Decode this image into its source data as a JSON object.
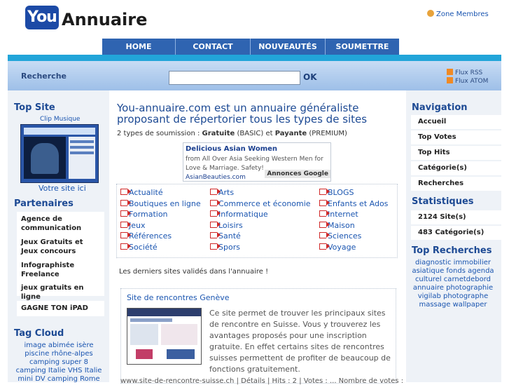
{
  "header": {
    "logo_you": "You",
    "logo_text": "Annuaire",
    "zone_membres": "Zone Membres"
  },
  "nav": [
    "HOME",
    "CONTACT",
    "NOUVEAUTÉS",
    "SOUMETTRE"
  ],
  "search": {
    "label": "Recherche",
    "ok": "OK",
    "feed_rss": "Flux RSS",
    "feed_atom": "Flux ATOM"
  },
  "left": {
    "top_site_title": "Top Site",
    "top_site_caption": "Clip Musique",
    "votre_site": "Votre site ici",
    "partenaires_title": "Partenaires",
    "partenaires": [
      "Agence de communication",
      "Jeux Gratuits et Jeux concours",
      "Infographiste Freelance",
      "jeux gratuits en ligne",
      "GAGNE TON iPAD"
    ],
    "tag_cloud_title": "Tag Cloud",
    "tag_cloud_text": "image abimée isère piscine rhône-alpes camping super 8 camping Italie VHS Italie mini DV camping Rome"
  },
  "main": {
    "title": "You-annuaire.com est un annuaire généraliste proposant de répertorier tous les types de sites",
    "soumission_prefix": "2 types de soumission : ",
    "soumission_gratuite": "Gratuite",
    "soumission_mid": " (BASIC) et ",
    "soumission_payante": "Payante",
    "soumission_suffix": " (PREMIUM)",
    "ad": {
      "title": "Delicious Asian Women",
      "text": "from All Over Asia Seeking Western Men for Love & Marriage. Safety!",
      "url": "AsianBeauties.com",
      "badge": "Annonces Google"
    },
    "categories": [
      [
        "Actualité",
        "Arts",
        "BLOGS"
      ],
      [
        "Boutiques en ligne",
        "Commerce et économie",
        "Enfants et Ados"
      ],
      [
        "Formation",
        "Informatique",
        "Internet"
      ],
      [
        "Jeux",
        "Loisirs",
        "Maison"
      ],
      [
        "Références",
        "Santé",
        "Sciences"
      ],
      [
        "Société",
        "Spors",
        "Voyage"
      ]
    ],
    "derniers": "Les derniers sites validés dans l'annuaire !",
    "site": {
      "title": "Site de rencontres Genève",
      "description": "Ce site permet de trouver les principaux sites de rencontre en Suisse. Vous y trouverez les avantages proposés pour une inscription gratuite. En effet certains sites de rencontres suisses permettent de profiter de beaucoup de fonctions gratuitement.",
      "footer": "www.site-de-rencontre-suisse.ch | Détails | Hits : 2 | Votes : ... Nombre de votes :"
    }
  },
  "right": {
    "navigation_title": "Navigation",
    "navigation": [
      "Accueil",
      "Top Votes",
      "Top Hits",
      "Catégorie(s)",
      "Recherches"
    ],
    "stats_title": "Statistiques",
    "stats": [
      "2124 Site(s)",
      "483 Catégorie(s)"
    ],
    "top_recherches_title": "Top Recherches",
    "top_recherches_text": "diagnostic immobilier asiatique fonds agenda culturel carnetdebord annuaire photographie vigilab photographe massage wallpaper"
  },
  "colors": {
    "nav_blue": "#2f64b1",
    "accent_cyan": "#22a5d9",
    "title_blue": "#1d4a94",
    "link_blue": "#1a55b0",
    "arrow_red": "#d02828"
  }
}
